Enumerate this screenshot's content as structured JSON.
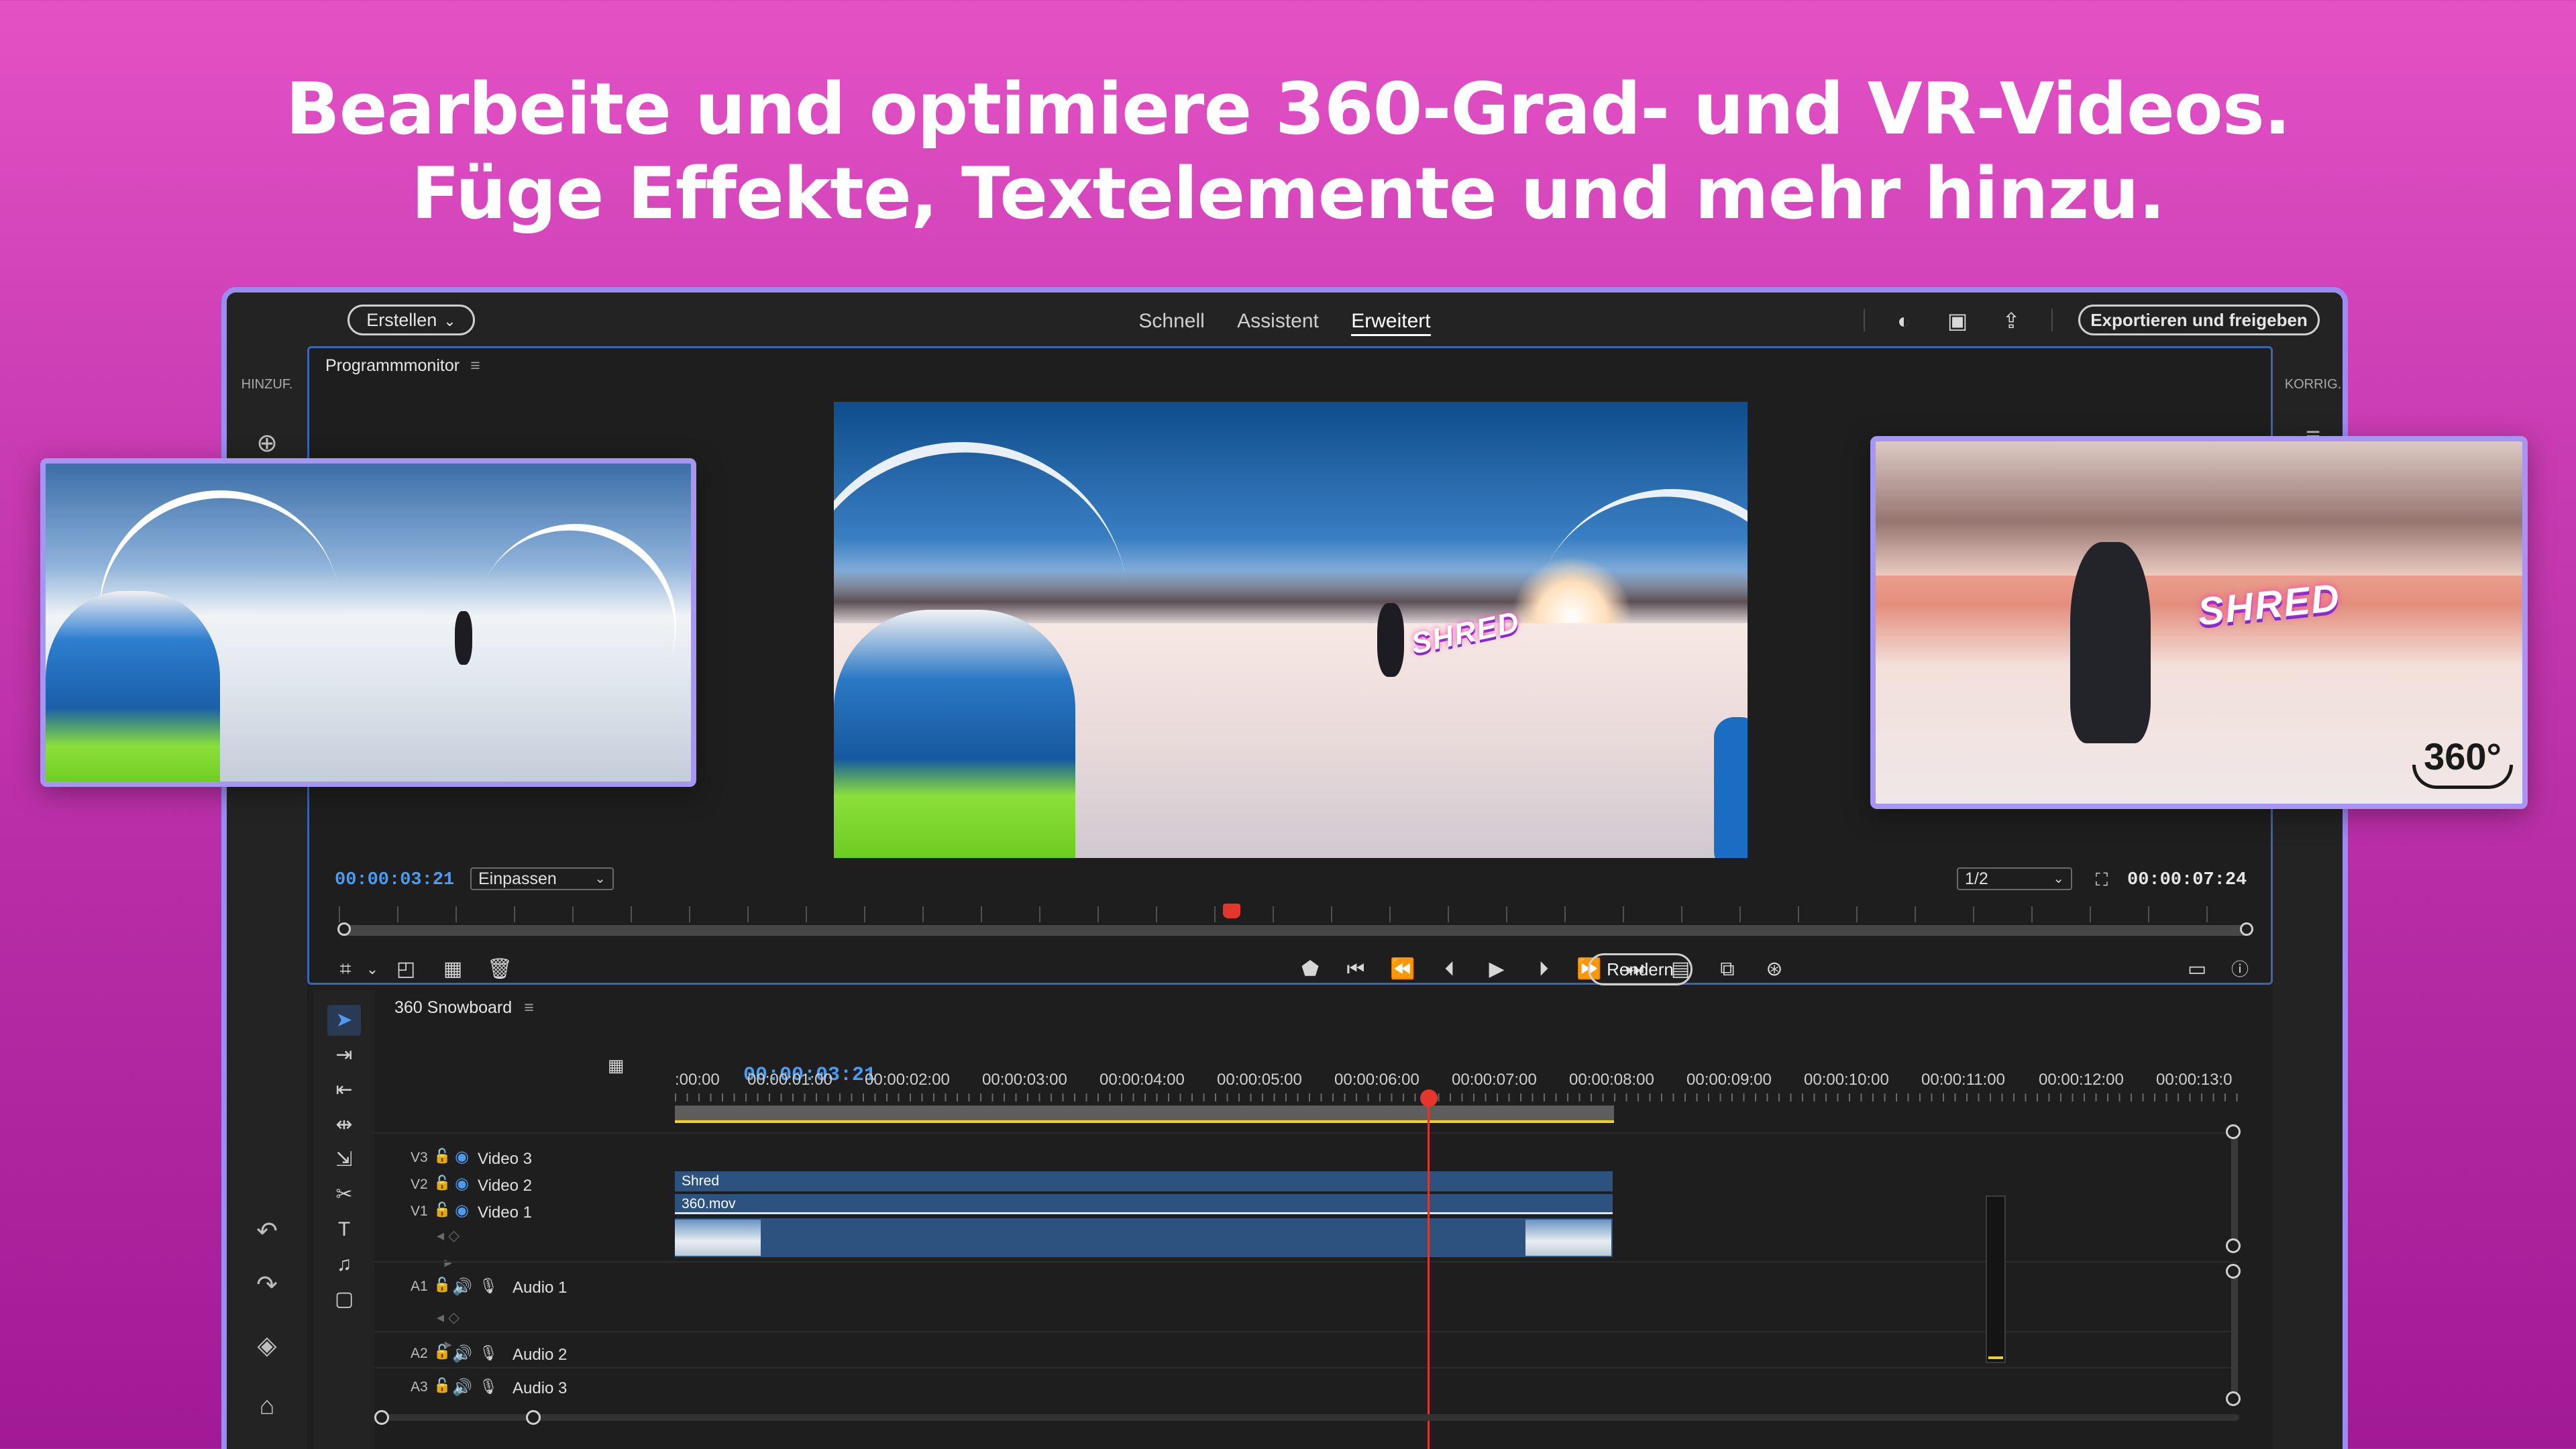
{
  "headline": {
    "line1": "Bearbeite und optimiere 360-Grad- und VR-Videos.",
    "line2": "Füge Effekte, Textelemente und mehr hinzu."
  },
  "topbar": {
    "create_label": "Erstellen",
    "tabs": [
      {
        "label": "Schnell",
        "active": false
      },
      {
        "label": "Assistent",
        "active": false
      },
      {
        "label": "Erweitert",
        "active": true
      }
    ],
    "export_label": "Exportieren und freigeben"
  },
  "sidebar_left": {
    "label": "HINZUF."
  },
  "sidebar_right": {
    "label": "KORRIG."
  },
  "program_monitor": {
    "title": "Programmmonitor",
    "overlay_text": "SHRED",
    "current_time": "00:00:03:21",
    "zoom_select": "Einpassen",
    "resolution_select": "1/2",
    "duration": "00:00:07:24",
    "render_label": "Rendern"
  },
  "timeline": {
    "sequence_name": "360 Snowboard",
    "current_time": "00:00:03:21",
    "ruler_labels": [
      ":00:00",
      "00:00:01:00",
      "00:00:02:00",
      "00:00:03:00",
      "00:00:04:00",
      "00:00:05:00",
      "00:00:06:00",
      "00:00:07:00",
      "00:00:08:00",
      "00:00:09:00",
      "00:00:10:00",
      "00:00:11:00",
      "00:00:12:00",
      "00:00:13:0"
    ],
    "video_tracks": [
      {
        "id": "V3",
        "name": "Video 3"
      },
      {
        "id": "V2",
        "name": "Video 2"
      },
      {
        "id": "V1",
        "name": "Video 1"
      }
    ],
    "audio_tracks": [
      {
        "id": "A1",
        "name": "Audio 1"
      },
      {
        "id": "A2",
        "name": "Audio 2"
      },
      {
        "id": "A3",
        "name": "Audio 3"
      }
    ],
    "clips": {
      "title_clip": "Shred",
      "video_clip": "360.mov"
    }
  },
  "right_thumbnail": {
    "overlay_text": "SHRED",
    "badge": "360°"
  },
  "colors": {
    "accent_blue": "#4b9cf1",
    "playhead_red": "#e5362c",
    "frame_purple": "#a795f2",
    "workarea_yellow": "#f2d21c"
  }
}
